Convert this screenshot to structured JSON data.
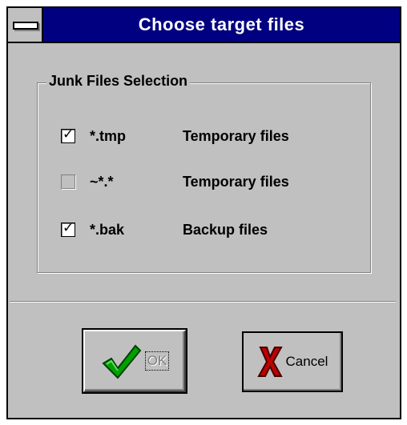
{
  "window": {
    "title": "Choose target files"
  },
  "group": {
    "label": "Junk Files Selection",
    "items": [
      {
        "pattern": "*.tmp",
        "description": "Temporary files",
        "checked": true,
        "enabled": true
      },
      {
        "pattern": "~*.*",
        "description": "Temporary files",
        "checked": false,
        "enabled": false
      },
      {
        "pattern": "*.bak",
        "description": "Backup files",
        "checked": true,
        "enabled": true
      }
    ]
  },
  "buttons": {
    "ok_label": "OK",
    "cancel_label": "Cancel"
  },
  "icons": {
    "ok": "green-checkmark-icon",
    "cancel": "red-x-icon"
  },
  "colors": {
    "titlebar": "#000080",
    "face": "#c0c0c0",
    "ok_icon": "#00a000",
    "cancel_icon": "#c00000"
  }
}
